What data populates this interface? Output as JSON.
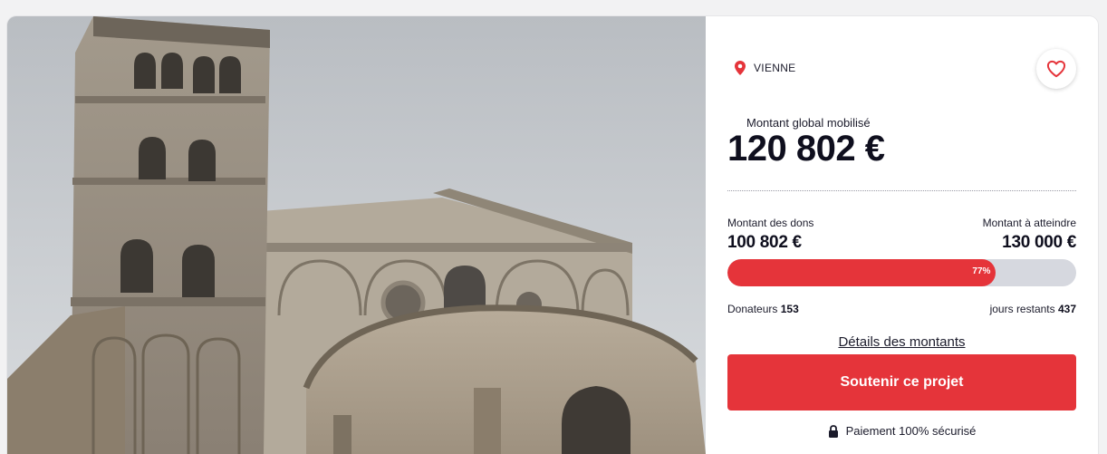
{
  "project": {
    "image_alt": "Église Saint-André-le-Bas, Vienne",
    "location": "VIENNE",
    "global_label": "Montant global mobilisé",
    "global_amount": "120 802 €",
    "donations_label": "Montant des dons",
    "donations_value": "100 802 €",
    "target_label": "Montant à atteindre",
    "target_value": "130 000 €",
    "progress_fraction": 0.77,
    "progress_label": "77%",
    "donors_label": "Donateurs",
    "donors_value": "153",
    "days_label": "jours restants",
    "days_value": "437",
    "details_link": "Détails des montants",
    "support_button": "Soutenir ce projet",
    "secure_text": "Paiement 100% sécurisé"
  },
  "colors": {
    "accent": "#e5343a",
    "bar_track": "#d6d8df",
    "text_dark": "#0f0f1e"
  },
  "icons": {
    "location": "map-pin-icon",
    "favorite": "heart-outline-icon",
    "secure": "padlock-icon"
  }
}
